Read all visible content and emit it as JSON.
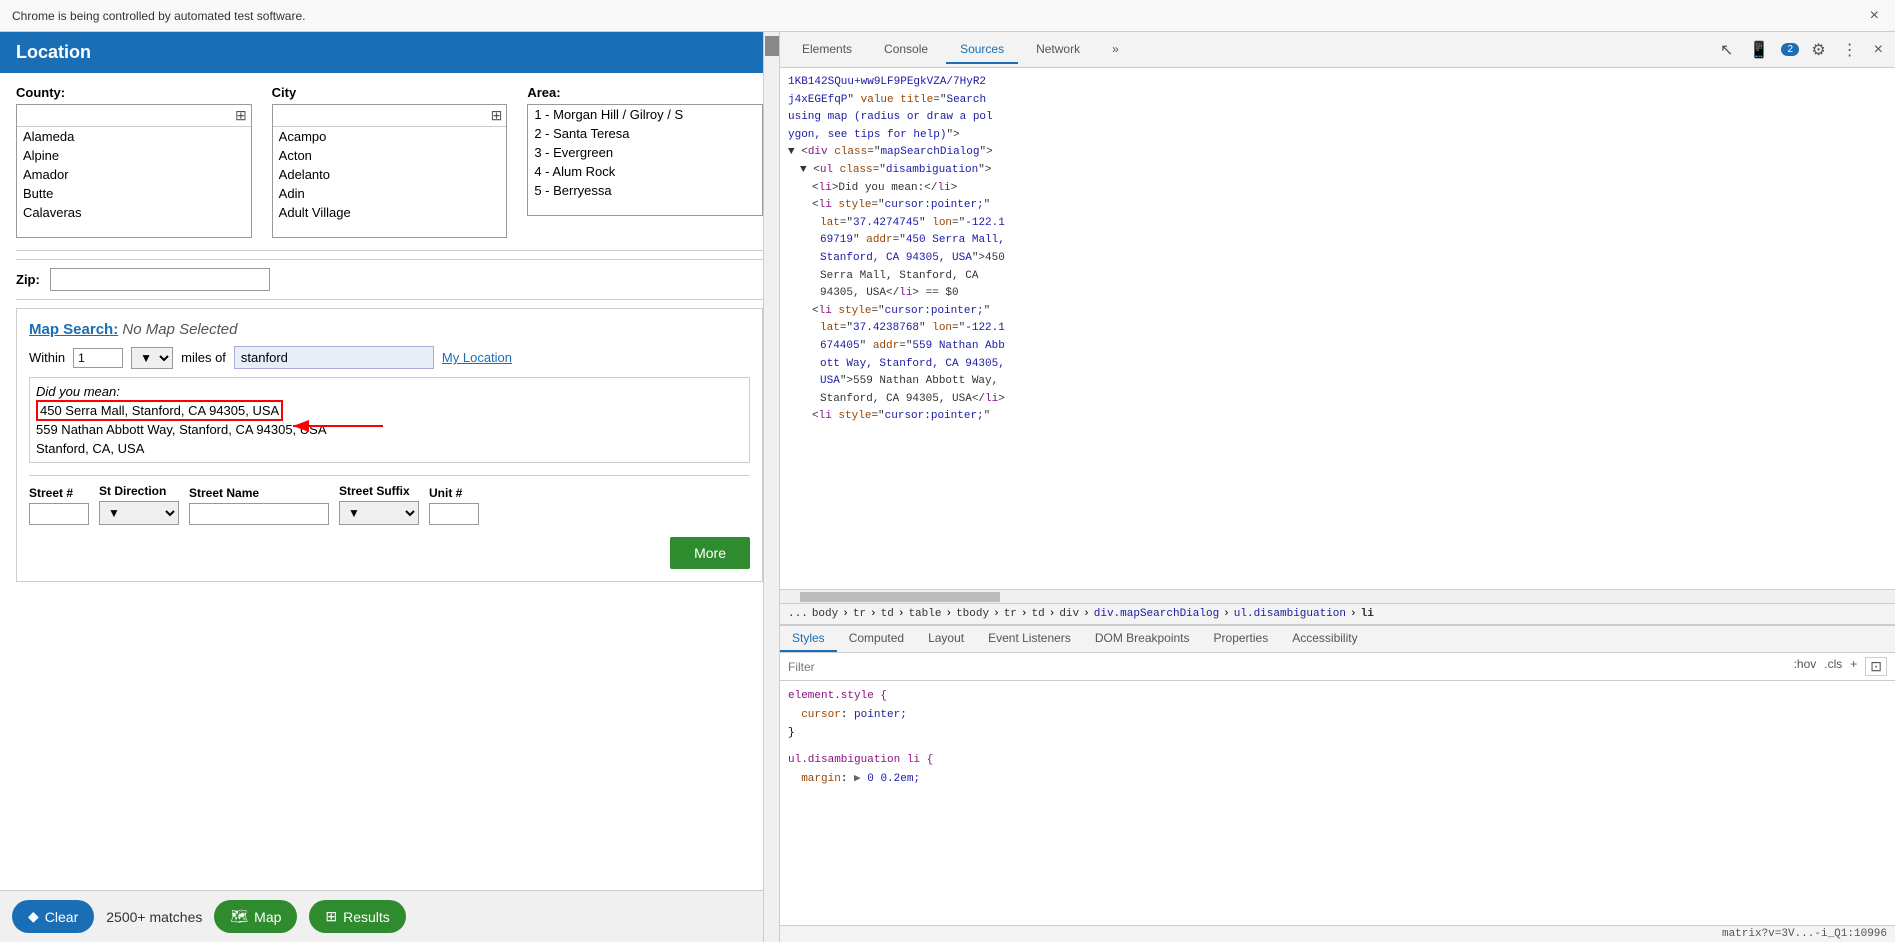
{
  "chrome_bar": {
    "message": "Chrome is being controlled by automated test software.",
    "close_label": "×"
  },
  "location_panel": {
    "header": "Location",
    "county_label": "County:",
    "city_label": "City",
    "area_label": "Area:",
    "counties": [
      "Alameda",
      "Alpine",
      "Amador",
      "Butte",
      "Calaveras"
    ],
    "cities": [
      "Acampo",
      "Acton",
      "Adelanto",
      "Adin",
      "Adult Village"
    ],
    "areas": [
      "1 - Morgan Hill / Gilroy / S",
      "2 - Santa Teresa",
      "3 - Evergreen",
      "4 - Alum Rock",
      "5 - Berryessa"
    ],
    "zip_label": "Zip:",
    "map_search_label": "Map Search:",
    "map_search_link": "Map Search:",
    "no_map_selected": "No Map Selected",
    "within_label": "Within",
    "within_value": "1",
    "miles_label": "miles of",
    "location_value": "stanford",
    "my_location_link": "My Location",
    "did_you_mean": "Did you mean:",
    "suggestions": [
      "450 Serra Mall, Stanford, CA 94305, USA",
      "559 Nathan Abbott Way, Stanford, CA 94305, USA",
      "Stanford, CA, USA"
    ],
    "street_num_label": "Street #",
    "st_direction_label": "St Direction",
    "street_name_label": "Street Name",
    "street_suffix_label": "Street Suffix",
    "unit_label": "Unit #",
    "more_btn": "More"
  },
  "bottom_bar": {
    "clear_label": "Clear",
    "matches": "2500+ matches",
    "map_label": "Map",
    "results_label": "Results"
  },
  "devtools": {
    "tabs": [
      "Elements",
      "Console",
      "Sources",
      "Network",
      "»"
    ],
    "active_tab": "Elements",
    "badge_count": "2",
    "code_lines": [
      "1KB142SQuu+ww9LF9PEgkVZA/7HyR2",
      "j4xEGEfqP\" value title=\"Search",
      "using map (radius or draw a pol",
      "ygon, see tips for help)\">",
      "▼ <div class=\"mapSearchDialog\">",
      "  ▼ <ul class=\"disambiguation\">",
      "      <li>Did you mean:</li>",
      "      <li style=\"cursor:pointer;\"",
      "        lat=\"37.4274745\" lon=\"-122.1",
      "        69719\" addr=\"450 Serra Mall,",
      "        Stanford, CA 94305, USA\">450",
      "        Serra Mall, Stanford, CA",
      "        94305, USA</li> == $0",
      "      <li style=\"cursor:pointer;\"",
      "        lat=\"37.4238768\" lon=\"-122.1",
      "        674405\" addr=\"559 Nathan Abb",
      "        ott Way, Stanford, CA 94305,",
      "        USA\">559 Nathan Abbott Way,",
      "        Stanford, CA 94305, USA</li>",
      "      <li style=\"cursor:pointer;\""
    ],
    "breadcrumb": "... body  tr  td  table  tbody  tr  td  div  div.mapSearchDialog  ul.disambiguation  li",
    "styles_tabs": [
      "Styles",
      "Computed",
      "Layout",
      "Event Listeners",
      "DOM Breakpoints",
      "Properties",
      "Accessibility"
    ],
    "filter_placeholder": "Filter",
    "filter_actions": [
      ":hov",
      ".cls",
      "+"
    ],
    "style_rules": [
      {
        "selector": "element.style {",
        "props": [
          {
            "prop": "cursor",
            "val": "pointer;"
          }
        ],
        "close": "}"
      },
      {
        "selector": "ul.disambiguation li {",
        "props": [
          {
            "prop": "margin",
            "val": "▶ 0 0.2em;"
          }
        ]
      }
    ],
    "status_text": "matrix?v=3V...-i_Q1:10996",
    "ca_text": "CA"
  }
}
